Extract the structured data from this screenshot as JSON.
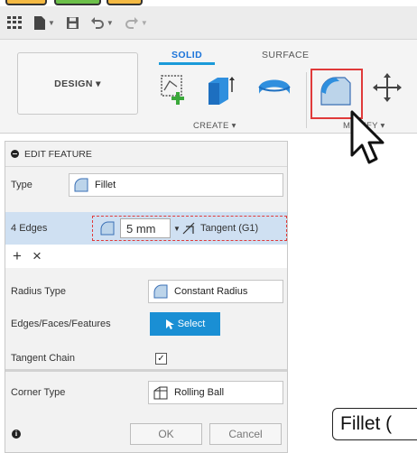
{
  "toolbar": {
    "icons": [
      "grid-menu-icon",
      "file-icon",
      "save-icon",
      "undo-icon",
      "redo-icon"
    ]
  },
  "ribbon": {
    "design_label": "DESIGN ▾",
    "tabs": [
      {
        "label": "SOLID",
        "active": true
      },
      {
        "label": "SURFACE",
        "active": false
      }
    ],
    "create_label": "CREATE ▾",
    "modify_label": "MODIFY ▾"
  },
  "panel": {
    "title": "EDIT FEATURE",
    "type_label": "Type",
    "type_value": "Fillet",
    "edges_count": "4",
    "edges_label": "Edges",
    "radius_value": "5 mm",
    "tangent_value": "Tangent (G1)",
    "add_symbol": "+",
    "remove_symbol": "×",
    "radius_type_label": "Radius Type",
    "radius_type_value": "Constant Radius",
    "select_label": "Edges/Faces/Features",
    "select_button": "Select",
    "tangent_chain_label": "Tangent Chain",
    "tangent_chain_checked": true,
    "checkmark": "✓",
    "corner_type_label": "Corner Type",
    "corner_type_value": "Rolling Ball",
    "info_symbol": "i",
    "ok_label": "OK",
    "cancel_label": "Cancel"
  },
  "caption": {
    "text": "Fillet ("
  },
  "colors": {
    "accent": "#1a8fd4",
    "highlight": "#e03a3a",
    "selection": "#cfe0f2"
  }
}
